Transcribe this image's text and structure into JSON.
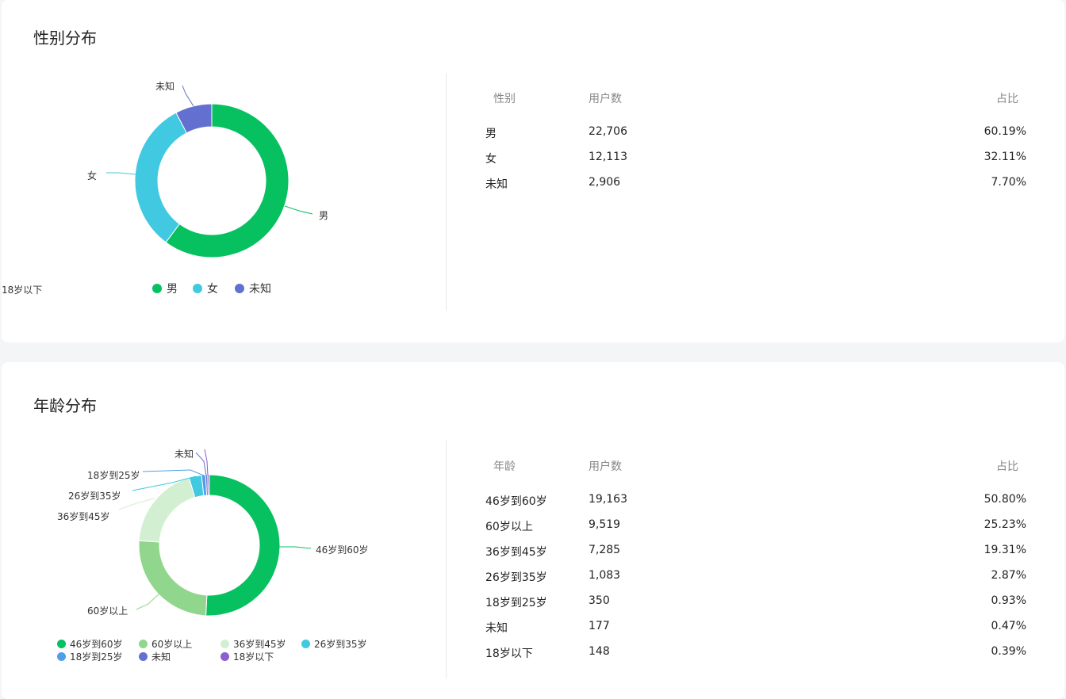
{
  "gender": {
    "title": "性别分布",
    "table": {
      "headers": [
        "性别",
        "用户数",
        "占比"
      ],
      "rows": [
        [
          "男",
          "22,706",
          "60.19%"
        ],
        [
          "女",
          "12,113",
          "32.11%"
        ],
        [
          "未知",
          "2,906",
          "7.70%"
        ]
      ]
    },
    "legend": [
      "男",
      "女",
      "未知"
    ]
  },
  "age": {
    "title": "年龄分布",
    "table": {
      "headers": [
        "年龄",
        "用户数",
        "占比"
      ],
      "rows": [
        [
          "46岁到60岁",
          "19,163",
          "50.80%"
        ],
        [
          "60岁以上",
          "9,519",
          "25.23%"
        ],
        [
          "36岁到45岁",
          "7,285",
          "19.31%"
        ],
        [
          "26岁到35岁",
          "1,083",
          "2.87%"
        ],
        [
          "18岁到25岁",
          "350",
          "0.93%"
        ],
        [
          "未知",
          "177",
          "0.47%"
        ],
        [
          "18岁以下",
          "148",
          "0.39%"
        ]
      ]
    },
    "legend": [
      "46岁到60岁",
      "60岁以上",
      "36岁到45岁",
      "26岁到35岁",
      "18岁到25岁",
      "未知",
      "18岁以下"
    ]
  },
  "chart_data": [
    {
      "type": "pie",
      "title": "性别分布",
      "categories": [
        "男",
        "女",
        "未知"
      ],
      "values": [
        22706,
        12113,
        2906
      ],
      "percents": [
        60.19,
        32.11,
        7.7
      ],
      "colors": [
        "#07c160",
        "#40c9e0",
        "#6470cf"
      ],
      "legend_position": "bottom"
    },
    {
      "type": "pie",
      "title": "年龄分布",
      "categories": [
        "46岁到60岁",
        "60岁以上",
        "36岁到45岁",
        "26岁到35岁",
        "18岁到25岁",
        "未知",
        "18岁以下"
      ],
      "values": [
        19163,
        9519,
        7285,
        1083,
        350,
        177,
        148
      ],
      "percents": [
        50.8,
        25.23,
        19.31,
        2.87,
        0.93,
        0.47,
        0.39
      ],
      "colors": [
        "#07c160",
        "#90d68c",
        "#d3efd2",
        "#40c9e0",
        "#4e9ee8",
        "#6470cf",
        "#8c5fd0"
      ],
      "legend_position": "bottom"
    }
  ]
}
